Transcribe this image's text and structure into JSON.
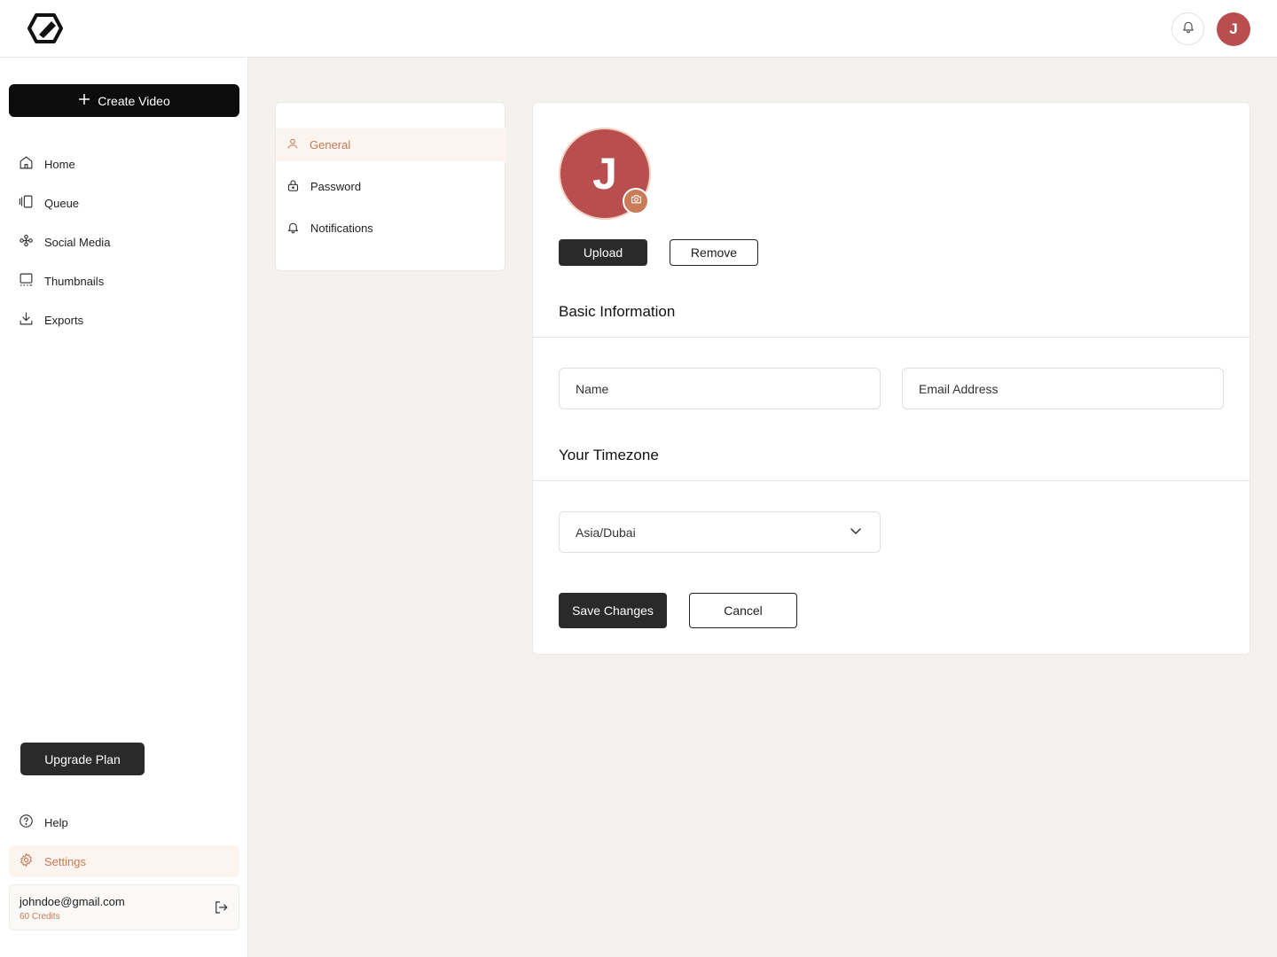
{
  "header": {
    "notifications_icon": "bell-icon",
    "avatar_initial": "J"
  },
  "sidebar": {
    "create_label": "Create Video",
    "nav": [
      {
        "label": "Home",
        "icon": "home-icon"
      },
      {
        "label": "Queue",
        "icon": "queue-icon"
      },
      {
        "label": "Social Media",
        "icon": "social-media-icon"
      },
      {
        "label": "Thumbnails",
        "icon": "thumbnails-icon"
      },
      {
        "label": "Exports",
        "icon": "download-icon"
      }
    ],
    "upgrade_label": "Upgrade Plan",
    "help_label": "Help",
    "settings_label": "Settings",
    "account": {
      "email": "johndoe@gmail.com",
      "credits": "60 Credits"
    }
  },
  "settings_menu": {
    "items": [
      {
        "label": "General",
        "icon": "user-icon",
        "active": true
      },
      {
        "label": "Password",
        "icon": "lock-icon",
        "active": false
      },
      {
        "label": "Notifications",
        "icon": "bell-icon",
        "active": false
      }
    ]
  },
  "profile": {
    "avatar_initial": "J",
    "upload_label": "Upload",
    "remove_label": "Remove",
    "basic_info_title": "Basic Information",
    "name_placeholder": "Name",
    "email_placeholder": "Email Address",
    "timezone_title": "Your Timezone",
    "timezone_value": "Asia/Dubai",
    "save_label": "Save Changes",
    "cancel_label": "Cancel"
  },
  "colors": {
    "accent": "#c77a55",
    "avatar": "#b84e4e",
    "dark": "#2a2a2a"
  }
}
